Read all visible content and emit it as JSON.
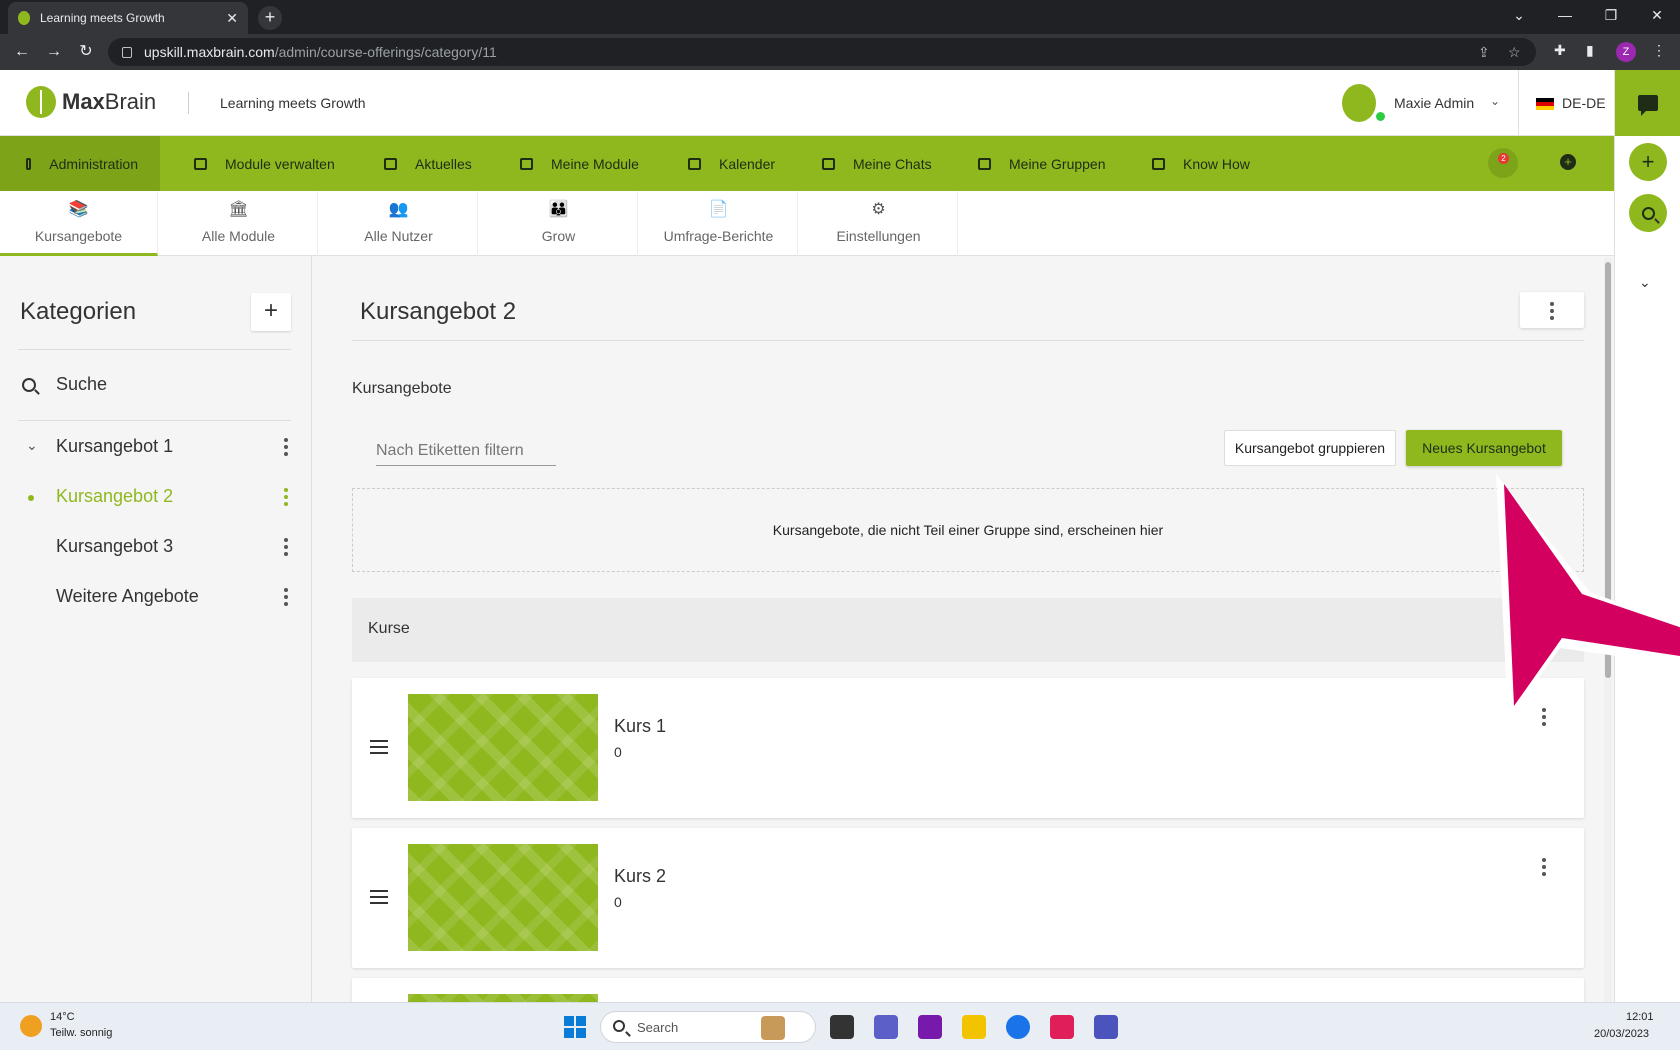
{
  "browser": {
    "tab_title": "Learning meets Growth",
    "url_host": "upskill.maxbrain.com",
    "url_path": "/admin/course-offerings/category/11",
    "profile_initial": "Z"
  },
  "header": {
    "logo_bold": "Max",
    "logo_light": "Brain",
    "tagline": "Learning meets Growth",
    "user_name": "Maxie Admin",
    "language": "DE-DE"
  },
  "nav": {
    "items": [
      {
        "label": "Administration",
        "icon": "admin-icon"
      },
      {
        "label": "Module verwalten",
        "icon": "modules-icon"
      },
      {
        "label": "Aktuelles",
        "icon": "news-icon"
      },
      {
        "label": "Meine Module",
        "icon": "graduation-cap-icon"
      },
      {
        "label": "Kalender",
        "icon": "calendar-icon"
      },
      {
        "label": "Meine Chats",
        "icon": "chat-icon"
      },
      {
        "label": "Meine Gruppen",
        "icon": "groups-icon"
      },
      {
        "label": "Know How",
        "icon": "book-icon"
      }
    ],
    "notification_count": "2"
  },
  "subtabs": [
    {
      "label": "Kursangebote",
      "icon": "course-offerings-icon"
    },
    {
      "label": "Alle Module",
      "icon": "bank-icon"
    },
    {
      "label": "Alle Nutzer",
      "icon": "users-icon"
    },
    {
      "label": "Grow",
      "icon": "group-icon"
    },
    {
      "label": "Umfrage-Berichte",
      "icon": "report-icon"
    },
    {
      "label": "Einstellungen",
      "icon": "gears-icon"
    }
  ],
  "sidebar": {
    "title": "Kategorien",
    "search_label": "Suche",
    "categories": [
      {
        "label": "Kursangebot 1"
      },
      {
        "label": "Kursangebot 2"
      },
      {
        "label": "Kursangebot 3"
      },
      {
        "label": "Weitere Angebote"
      }
    ]
  },
  "main": {
    "title": "Kursangebot 2",
    "section_label": "Kursangebote",
    "filter_placeholder": "Nach Etiketten filtern",
    "group_button": "Kursangebot gruppieren",
    "new_button": "Neues Kursangebot",
    "dropzone_text": "Kursangebote, die nicht Teil einer Gruppe sind, erscheinen hier",
    "group_title": "Kurse",
    "courses": [
      {
        "name": "Kurs 1",
        "count": "0"
      },
      {
        "name": "Kurs 2",
        "count": "0"
      }
    ]
  },
  "taskbar": {
    "temperature": "14°C",
    "weather": "Teilw. sonnig",
    "search_label": "Search",
    "time": "12:01",
    "date": "20/03/2023"
  },
  "colors": {
    "accent": "#8fb81f",
    "cursor": "#d4005f"
  }
}
